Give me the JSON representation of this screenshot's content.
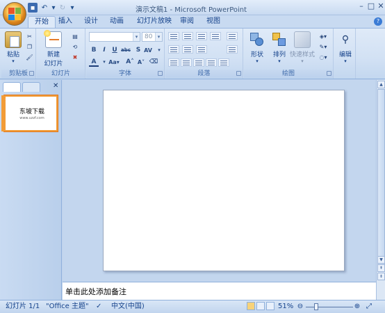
{
  "window": {
    "title": "演示文稿1 - Microsoft PowerPoint"
  },
  "tabs": [
    "开始",
    "插入",
    "设计",
    "动画",
    "幻灯片放映",
    "审阅",
    "视图"
  ],
  "ribbon": {
    "clipboard": {
      "label": "剪贴板",
      "paste": "粘贴"
    },
    "slides": {
      "label": "幻灯片",
      "new_slide_line1": "新建",
      "new_slide_line2": "幻灯片"
    },
    "font": {
      "label": "字体",
      "font_name": "",
      "font_size": "80"
    },
    "paragraph": {
      "label": "段落"
    },
    "drawing": {
      "label": "绘图",
      "shapes": "形状",
      "arrange": "排列",
      "quick_styles": "快速样式"
    },
    "editing": {
      "label": "编辑"
    }
  },
  "thumbnail": {
    "number": "1",
    "title": "东坡下载",
    "subtitle": "www.uzzf.com"
  },
  "notes": {
    "placeholder": "单击此处添加备注"
  },
  "status": {
    "slide": "幻灯片 1/1",
    "theme": "\"Office 主题\"",
    "language": "中文(中国)",
    "zoom": "51%"
  },
  "colors": {
    "accent": "#15428b",
    "ribbon": "#d2e1f4",
    "selection": "#f29c38"
  }
}
